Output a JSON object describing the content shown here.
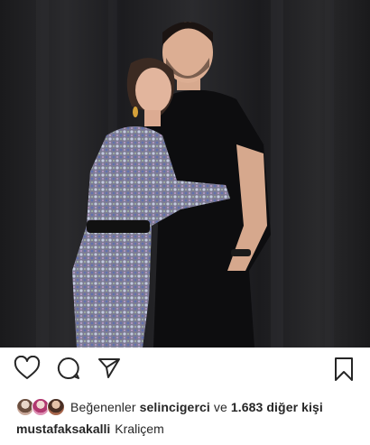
{
  "post": {
    "photo_alt": "",
    "actions": {
      "like_icon": "heart-icon",
      "comment_icon": "comment-icon",
      "share_icon": "paper-plane-icon",
      "save_icon": "bookmark-icon"
    },
    "likes": {
      "prefix": "Beğenenler",
      "user": "selincigerci",
      "connector": "ve",
      "count_text": "1.683 diğer kişi"
    },
    "caption": {
      "username": "mustafaksakalli",
      "text": "Kraliçem"
    }
  },
  "colors": {
    "text": "#262626",
    "background": "#ffffff",
    "photo_background": "#1f1f22"
  }
}
